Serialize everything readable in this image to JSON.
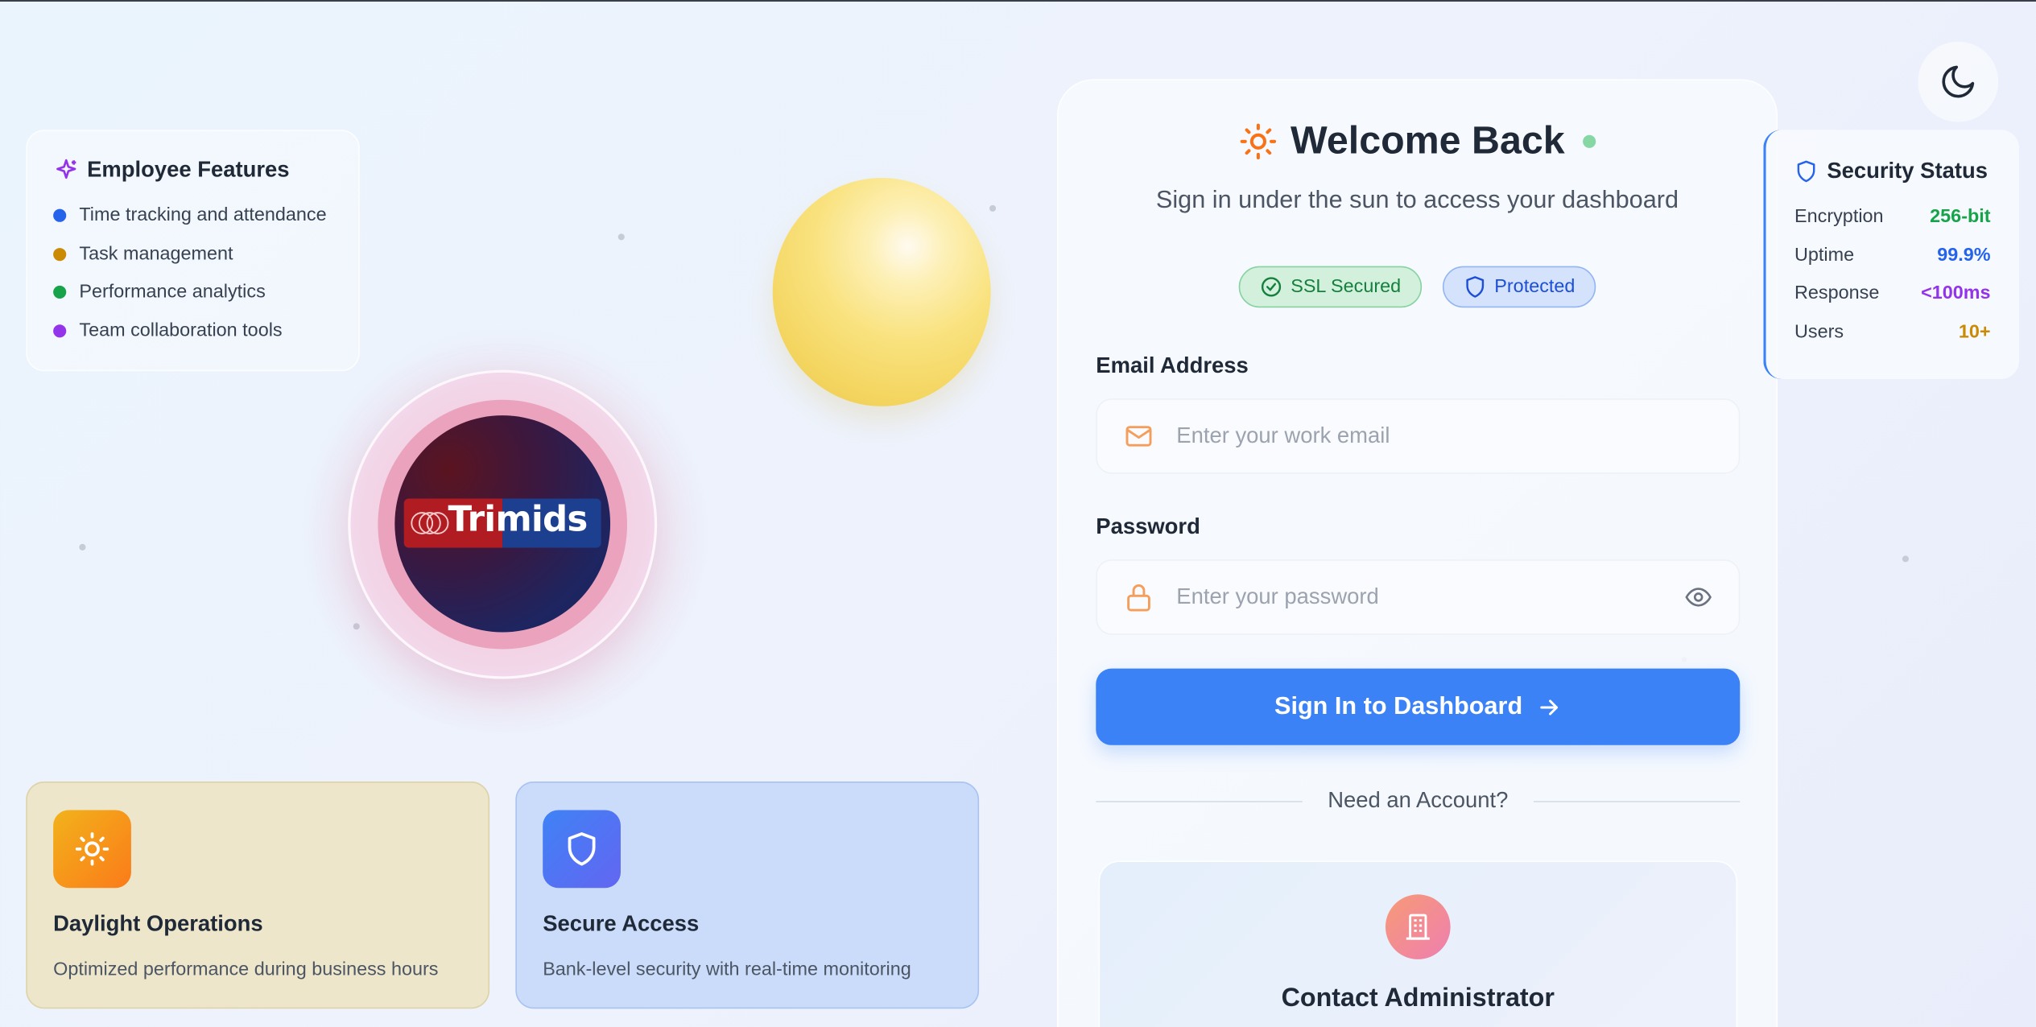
{
  "features": {
    "title": "Employee Features",
    "items": [
      {
        "label": "Time tracking and attendance",
        "color": "#2563eb"
      },
      {
        "label": "Task management",
        "color": "#ca8a04"
      },
      {
        "label": "Performance analytics",
        "color": "#16a34a"
      },
      {
        "label": "Team collaboration tools",
        "color": "#9333ea"
      }
    ]
  },
  "logo": {
    "brand": "Trimids"
  },
  "cards": {
    "daylight": {
      "title": "Daylight Operations",
      "description": "Optimized performance during business hours"
    },
    "secure": {
      "title": "Secure Access",
      "description": "Bank-level security with real-time monitoring"
    }
  },
  "login": {
    "title": "Welcome Back",
    "subtitle": "Sign in under the sun to access your dashboard",
    "badges": {
      "ssl": "SSL Secured",
      "protected": "Protected"
    },
    "email": {
      "label": "Email Address",
      "placeholder": "Enter your work email",
      "value": ""
    },
    "password": {
      "label": "Password",
      "placeholder": "Enter your password",
      "value": ""
    },
    "submit_label": "Sign In to Dashboard",
    "divider_label": "Need an Account?",
    "contact_label": "Contact Administrator"
  },
  "security": {
    "title": "Security Status",
    "rows": [
      {
        "label": "Encryption",
        "value": "256-bit",
        "color": "#16a34a"
      },
      {
        "label": "Uptime",
        "value": "99.9%",
        "color": "#2563eb"
      },
      {
        "label": "Response",
        "value": "<100ms",
        "color": "#9333ea"
      },
      {
        "label": "Users",
        "value": "10+",
        "color": "#ca8a04"
      }
    ]
  },
  "colors": {
    "accent": "#3b82f6",
    "sun": "#f97316"
  }
}
